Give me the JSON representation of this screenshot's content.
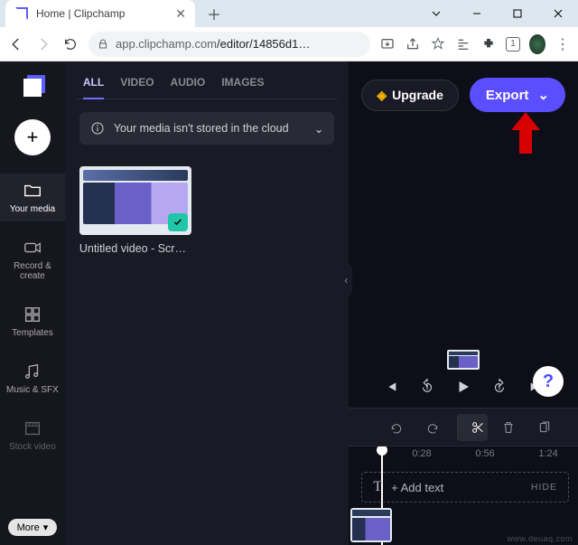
{
  "window": {
    "tab_title": "Home | Clipchamp",
    "url_host": "app.clipchamp.com",
    "url_path": "/editor/14856d1…"
  },
  "rail": {
    "items": [
      {
        "label": "Your media"
      },
      {
        "label": "Record & create"
      },
      {
        "label": "Templates"
      },
      {
        "label": "Music & SFX"
      },
      {
        "label": "Stock video"
      }
    ],
    "more": "More"
  },
  "panel": {
    "tabs": {
      "all": "ALL",
      "video": "VIDEO",
      "audio": "AUDIO",
      "images": "IMAGES"
    },
    "notice": "Your media isn't stored in the cloud",
    "media": [
      {
        "name": "Untitled video - Scre…"
      }
    ]
  },
  "header": {
    "upgrade": "Upgrade",
    "export": "Export"
  },
  "timeline": {
    "add_text": "+ Add text",
    "hide": "HIDE",
    "ticks": [
      "0:28",
      "0:56",
      "1:24"
    ]
  },
  "watermark": "www.deuaq.com"
}
